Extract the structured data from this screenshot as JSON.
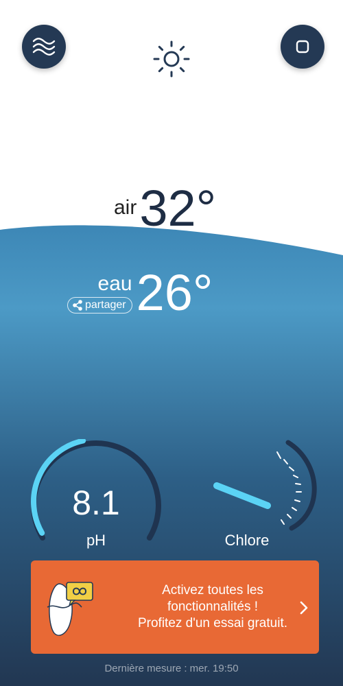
{
  "header": {
    "menu_icon": "waves-icon",
    "weather_icon": "sun-icon",
    "action_icon": "square-icon",
    "button_color": "#243954"
  },
  "temperatures": {
    "air_label": "air",
    "air_value": "32°",
    "water_label": "eau",
    "water_value": "26°",
    "share_label": "partager",
    "share_icon": "share-icon"
  },
  "gauges": {
    "ph": {
      "label": "pH",
      "value": "8.1",
      "fill_fraction": 0.45,
      "accent": "#5bd3f5"
    },
    "chlore": {
      "label": "Chlore"
    }
  },
  "promo": {
    "line1": "Activez toutes les",
    "line2": "fonctionnalités !",
    "line3": "Profitez d'un essai gratuit.",
    "background": "#e86935",
    "icon": "pool-sensor-icon",
    "chevron_icon": "chevron-right-icon"
  },
  "footer": {
    "last_measure": "Dernière mesure : mer. 19:50"
  },
  "colors": {
    "water_top": "#4a97c3",
    "water_bottom": "#243a56"
  }
}
